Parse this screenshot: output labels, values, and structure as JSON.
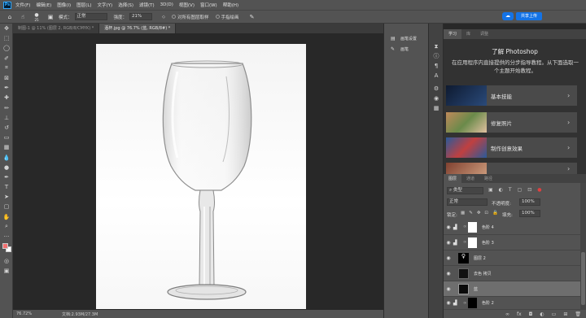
{
  "app": {
    "logo": "Ps"
  },
  "menu": [
    "文件(F)",
    "编辑(E)",
    "图像(I)",
    "图层(L)",
    "文字(Y)",
    "选择(S)",
    "滤镜(T)",
    "3D(D)",
    "视图(V)",
    "窗口(W)",
    "帮助(H)"
  ],
  "options": {
    "brush_size": "25",
    "mode_label": "模式：",
    "mode_value": "正常",
    "strength_label": "强度：",
    "strength_value": "21%",
    "sample_all": "对所有图层取样",
    "finger_paint": "手指绘画"
  },
  "share": {
    "label": "共享上传"
  },
  "tabs": [
    {
      "label": "制图-1 @ 11% (图层 2, RGB/8/CMYK) *",
      "active": false
    },
    {
      "label": "酒杯.jpg @ 76.7% (蓝, RGB/8#) *",
      "active": true
    }
  ],
  "status": {
    "zoom": "76.72%",
    "doc": "文档:2.93M/27.3M"
  },
  "mid_panel": [
    {
      "icon": "brush-settings-icon",
      "label": "画笔设置"
    },
    {
      "icon": "brush-icon",
      "label": "画笔"
    }
  ],
  "learn": {
    "tabs": [
      "学习",
      "库",
      "调整"
    ],
    "title": "了解 Photoshop",
    "desc": "在应用程序内直接提供的分步指导教程。从下面选取一个主题开始教程。",
    "cards": [
      {
        "label": "基本技能",
        "color": "#1d2a44"
      },
      {
        "label": "修复照片",
        "color": "#8a5a3a"
      },
      {
        "label": "制作创意效果",
        "color": "#3a5a8a"
      },
      {
        "label": "",
        "color": "#5a3a3a"
      }
    ]
  },
  "layers": {
    "tabs": [
      "图层",
      "通道",
      "路径"
    ],
    "filter": "类型",
    "blend": "正常",
    "opacity_label": "不透明度:",
    "opacity": "100%",
    "lock_label": "锁定:",
    "fill_label": "填充:",
    "fill": "100%",
    "items": [
      {
        "name": "色阶 4",
        "type": "adjust",
        "selected": false
      },
      {
        "name": "色阶 3",
        "type": "adjust",
        "selected": false
      },
      {
        "name": "图层 2",
        "type": "pixel-black",
        "selected": false
      },
      {
        "name": "去色 拷贝",
        "type": "glass",
        "selected": false
      },
      {
        "name": "蓝",
        "type": "glass",
        "selected": true
      },
      {
        "name": "色阶 2",
        "type": "adjust",
        "selected": false
      }
    ]
  }
}
